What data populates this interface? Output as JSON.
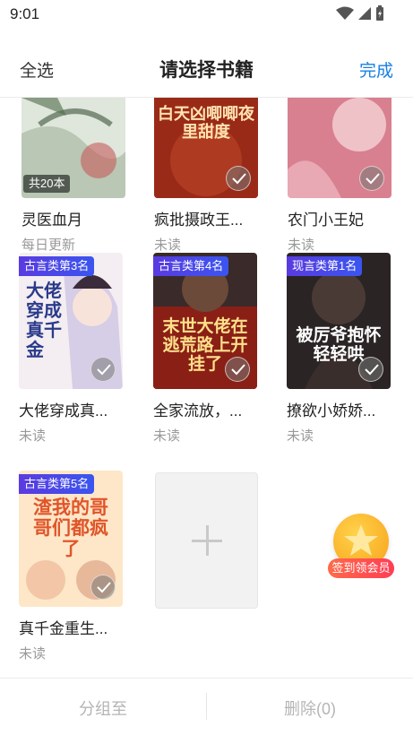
{
  "status_bar": {
    "time": "9:01"
  },
  "header": {
    "select_all": "全选",
    "title": "请选择书籍",
    "done": "完成"
  },
  "books": [
    {
      "title": "灵医血月",
      "subtitle": "每日更新",
      "count_badge": "共20本",
      "cover_text": ""
    },
    {
      "title": "疯批摄政王...",
      "subtitle": "未读",
      "cover_text": "白天凶唧唧夜里甜度"
    },
    {
      "title": "农门小王妃",
      "subtitle": "未读",
      "cover_text": ""
    },
    {
      "title": "大佬穿成真...",
      "subtitle": "未读",
      "rank": "古言类第3名",
      "cover_text": "大佬穿成真千金"
    },
    {
      "title": "全家流放，...",
      "subtitle": "未读",
      "rank": "古言类第4名",
      "cover_text": "末世大佬在逃荒路上开挂了"
    },
    {
      "title": "撩欲小娇娇...",
      "subtitle": "未读",
      "rank": "现言类第1名",
      "cover_text": "被厉爷抱怀轻轻哄"
    },
    {
      "title": "真千金重生...",
      "subtitle": "未读",
      "rank": "古言类第5名",
      "cover_text": "渣我的哥哥们都疯了"
    }
  ],
  "member_widget": {
    "label": "签到领会员"
  },
  "bottom_bar": {
    "group_label": "分组至",
    "delete_label": "删除(0)"
  },
  "colors": {
    "accent": "#1a7fe0",
    "rank_badge": "#4a45e8",
    "member": "#ff4a50"
  }
}
